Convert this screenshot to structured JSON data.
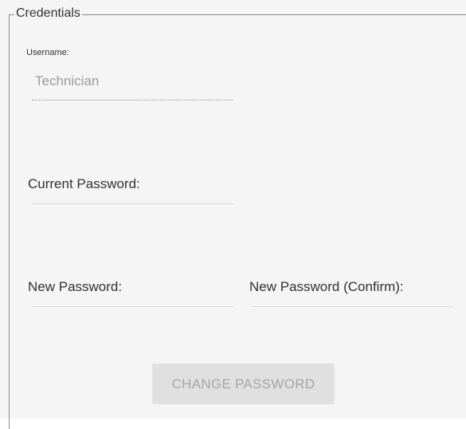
{
  "credentials": {
    "legend": "Credentials",
    "username": {
      "label": "Username:",
      "value": "Technician"
    },
    "current_password": {
      "label": "Current Password:",
      "value": ""
    },
    "new_password": {
      "label": "New Password:",
      "value": ""
    },
    "new_password_confirm": {
      "label": "New Password (Confirm):",
      "value": ""
    },
    "change_password_button": {
      "label": "CHANGE PASSWORD",
      "enabled": false
    }
  },
  "colors": {
    "panel_background": "#f5f5f5",
    "text": "#333333",
    "muted_text": "#9a9a9a",
    "button_background": "#e0e0e0",
    "button_text": "#a6a6a6"
  }
}
